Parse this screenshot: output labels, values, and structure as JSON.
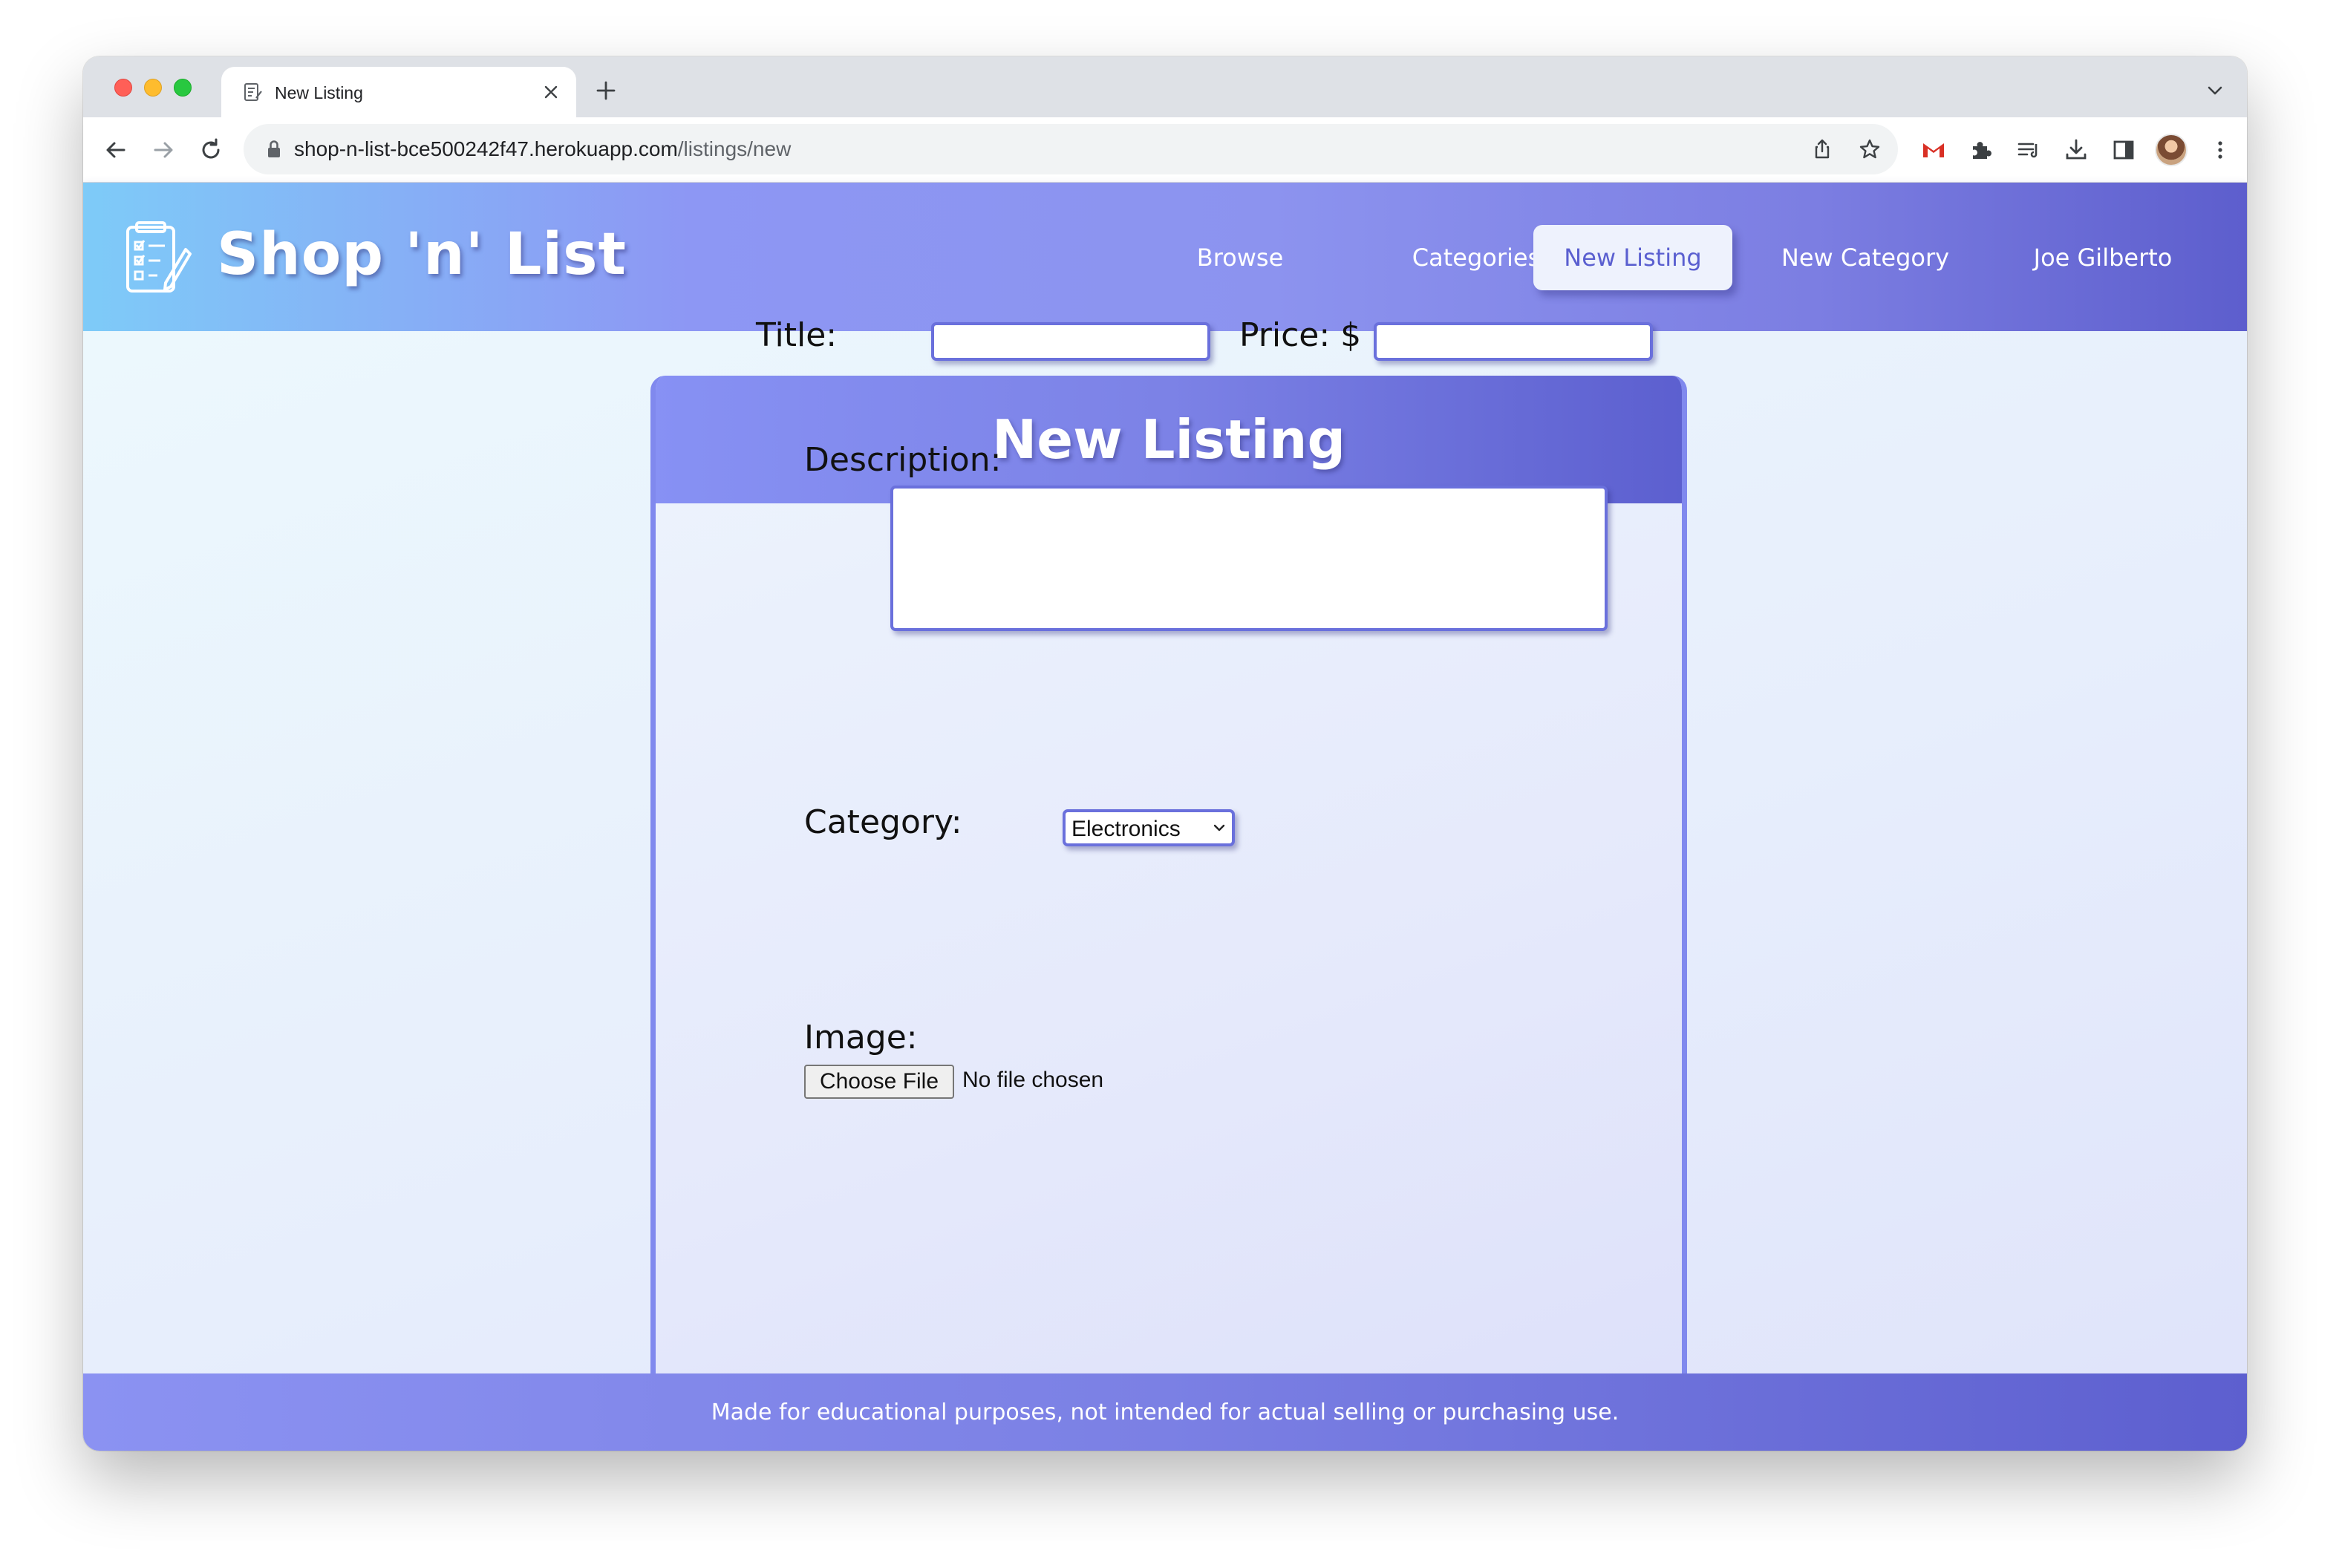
{
  "browser": {
    "tab_title": "New Listing",
    "url_host": "shop-n-list-bce500242f47.herokuapp.com",
    "url_path": "/listings/new"
  },
  "app": {
    "brand": "Shop 'n' List",
    "nav": {
      "browse": "Browse",
      "categories": "Categories",
      "new_listing": "New Listing",
      "new_category": "New Category",
      "user": "Joe Gilberto"
    },
    "active_nav": "new_listing"
  },
  "form": {
    "heading": "New Listing",
    "title_label": "Title:",
    "title_value": "",
    "price_label": "Price: $",
    "price_value": "",
    "description_label": "Description:",
    "description_value": "",
    "category_label": "Category:",
    "category_selected": "Electronics",
    "image_label": "Image:",
    "file_button": "Choose File",
    "file_status": "No file chosen"
  },
  "footer": {
    "text": "Made for educational purposes, not intended for actual selling or purchasing use."
  },
  "colors": {
    "accent": "#6a70dc",
    "header_start": "#7ecbf8",
    "header_end": "#5d5ecd",
    "active_nav_bg": "#eef2fd",
    "active_nav_text": "#5a5fd0"
  },
  "icons": {
    "favicon": "notepad-icon",
    "logo": "checklist-pencil-icon",
    "extensions": [
      "gmail-icon",
      "puzzle-icon",
      "media-queue-icon",
      "download-icon",
      "side-panel-icon"
    ]
  }
}
